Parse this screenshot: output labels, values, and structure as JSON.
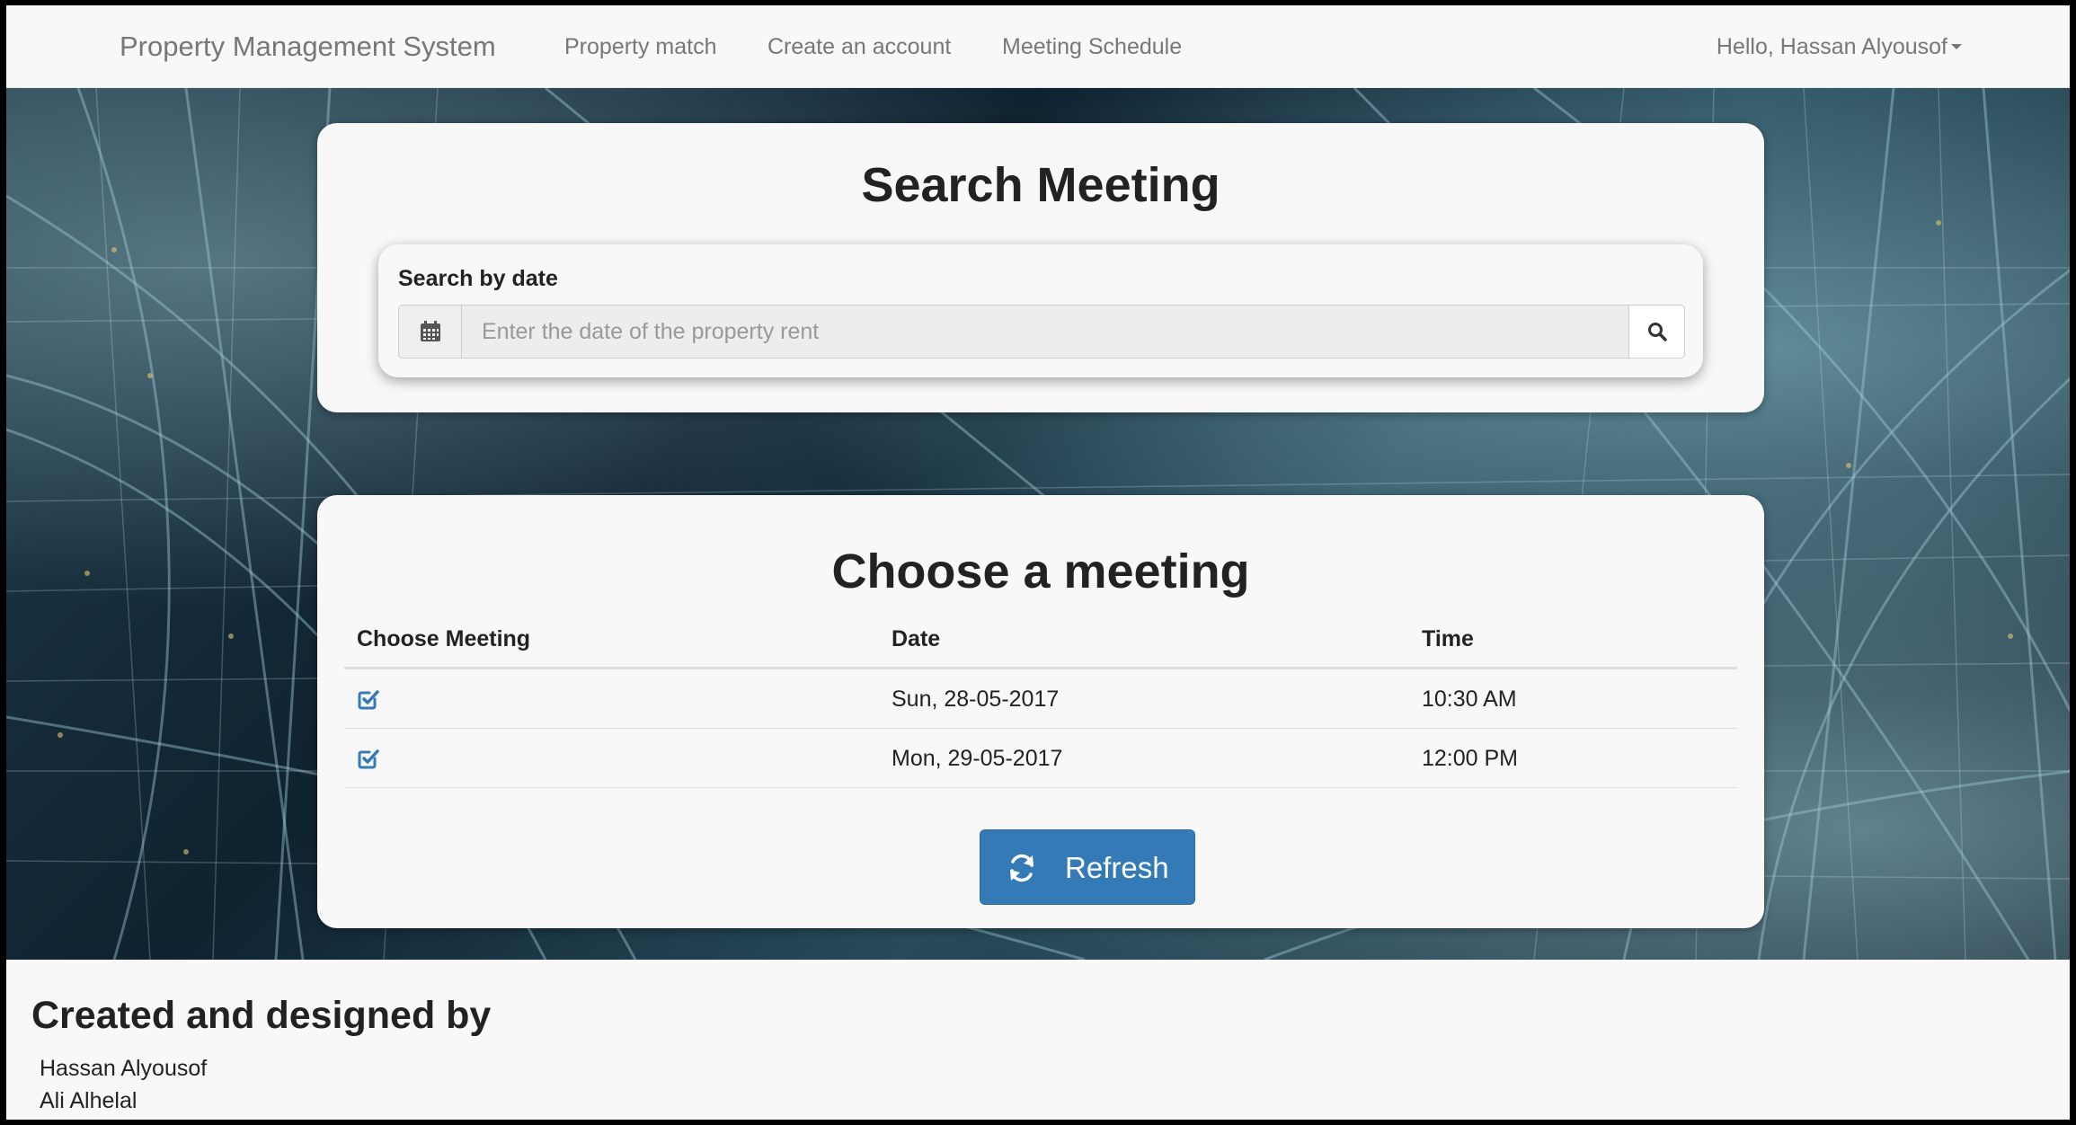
{
  "navbar": {
    "brand": "Property Management System",
    "links": [
      "Property match",
      "Create an account",
      "Meeting Schedule"
    ],
    "user": "Hello, Hassan Alyousof"
  },
  "search_panel": {
    "title": "Search Meeting",
    "label": "Search by date",
    "placeholder": "Enter the date of the property rent",
    "value": ""
  },
  "meeting_panel": {
    "title": "Choose a meeting",
    "columns": [
      "Choose Meeting",
      "Date",
      "Time"
    ],
    "rows": [
      {
        "date": "Sun, 28-05-2017",
        "time": "10:30 AM"
      },
      {
        "date": "Mon, 29-05-2017",
        "time": "12:00 PM"
      }
    ],
    "refresh_label": "Refresh"
  },
  "footer": {
    "title": "Created and designed by",
    "names": [
      "Hassan Alyousof",
      "Ali Alhelal"
    ]
  },
  "colors": {
    "primary": "#337ab7",
    "navbar_bg": "#f8f8f8",
    "nav_text": "#777777"
  },
  "icons": {
    "search_addon_left": "calendar-icon",
    "search_addon_right": "search-icon",
    "row_select": "check-square-icon",
    "refresh": "refresh-icon",
    "user_menu": "caret-down-icon"
  }
}
